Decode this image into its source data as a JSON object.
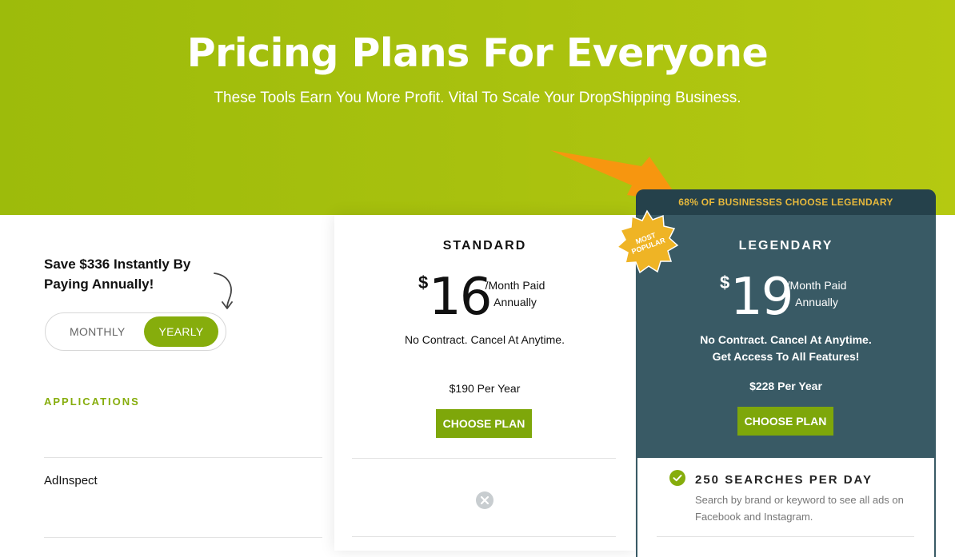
{
  "hero": {
    "title": "Pricing Plans For Everyone",
    "subtitle": "These Tools Earn You More Profit. Vital To Scale Your DropShipping Business."
  },
  "left": {
    "save_text": "Save $336 Instantly By Paying Annually!",
    "toggle": {
      "monthly": "MONTHLY",
      "yearly": "YEARLY",
      "selected": "YEARLY"
    },
    "applications_heading": "APPLICATIONS",
    "features": [
      "AdInspect"
    ]
  },
  "plans": {
    "standard": {
      "name": "STANDARD",
      "currency": "$",
      "price": "16",
      "per_line1": "/Month Paid",
      "per_line2": "Annually",
      "contract": "No Contract. Cancel At Anytime.",
      "per_year": "$190 Per Year",
      "button": "CHOOSE PLAN",
      "adinspect": "not-included"
    },
    "legendary": {
      "banner": "68% OF BUSINESSES CHOOSE LEGENDARY",
      "badge_line1": "MOST",
      "badge_line2": "POPULAR",
      "name": "LEGENDARY",
      "currency": "$",
      "price": "19",
      "per_line1": "/Month Paid",
      "per_line2": "Annually",
      "contract": "No Contract. Cancel At Anytime.",
      "access": "Get Access To All Features!",
      "per_year": "$228 Per Year",
      "button": "CHOOSE PLAN",
      "feature_title": "250 SEARCHES PER DAY",
      "feature_desc": "Search by brand or keyword to see all ads on Facebook and Instagram."
    }
  },
  "colors": {
    "accent_green": "#86ad0c",
    "legendary_bg": "#395a65",
    "banner_bg": "#25414b",
    "banner_text": "#e7b93c",
    "arrow_orange": "#f7960f",
    "badge_gold": "#efb425"
  },
  "icons": {
    "arrow": "orange-arrow-icon",
    "curly_arrow": "curly-arrow-icon",
    "not_included": "x-circle-icon",
    "included": "check-circle-icon",
    "badge": "star-badge-icon"
  }
}
